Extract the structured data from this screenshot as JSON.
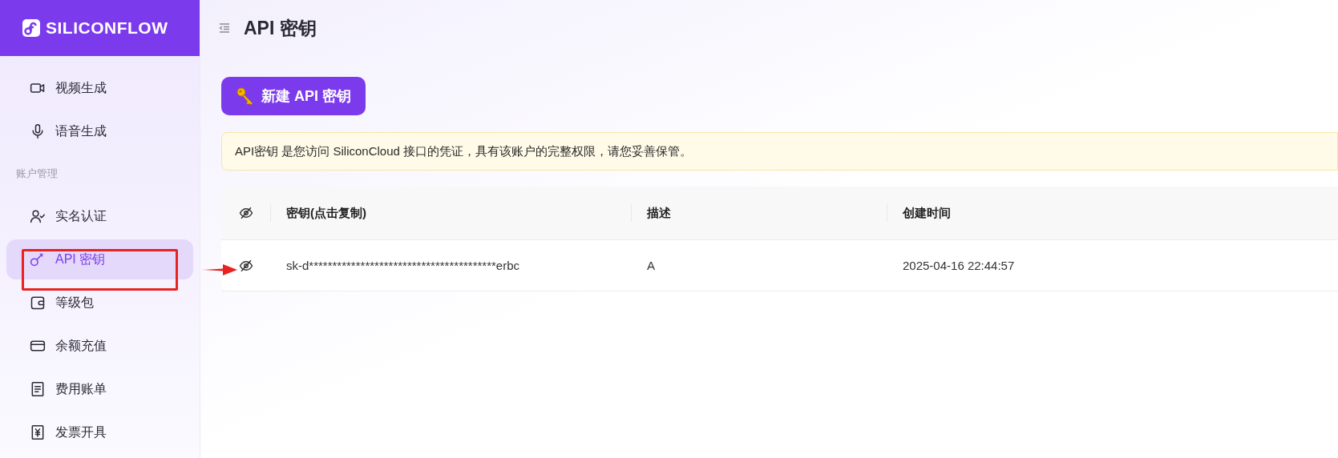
{
  "brand": {
    "name": "SILICONFLOW"
  },
  "sidebar": {
    "items": [
      {
        "kind": "item",
        "label": "视频生成",
        "selected": false
      },
      {
        "kind": "item",
        "label": "语音生成",
        "selected": false
      },
      {
        "kind": "heading",
        "label": "账户管理"
      },
      {
        "kind": "item",
        "label": "实名认证",
        "selected": false
      },
      {
        "kind": "item",
        "label": "API 密钥",
        "selected": true
      },
      {
        "kind": "item",
        "label": "等级包",
        "selected": false
      },
      {
        "kind": "item",
        "label": "余额充值",
        "selected": false
      },
      {
        "kind": "item",
        "label": "费用账单",
        "selected": false
      },
      {
        "kind": "item",
        "label": "发票开具",
        "selected": false
      }
    ]
  },
  "page": {
    "title": "API 密钥"
  },
  "new_key_button": {
    "label": "新建 API 密钥"
  },
  "notice": {
    "text": "API密钥 是您访问 SiliconCloud 接口的凭证，具有该账户的完整权限，请您妥善保管。"
  },
  "table": {
    "columns": [
      "密钥(点击复制)",
      "描述",
      "创建时间"
    ],
    "rows": [
      {
        "key": "sk-d****************************************erbc",
        "description": "A",
        "created": "2025-04-16 22:44:57"
      }
    ]
  }
}
